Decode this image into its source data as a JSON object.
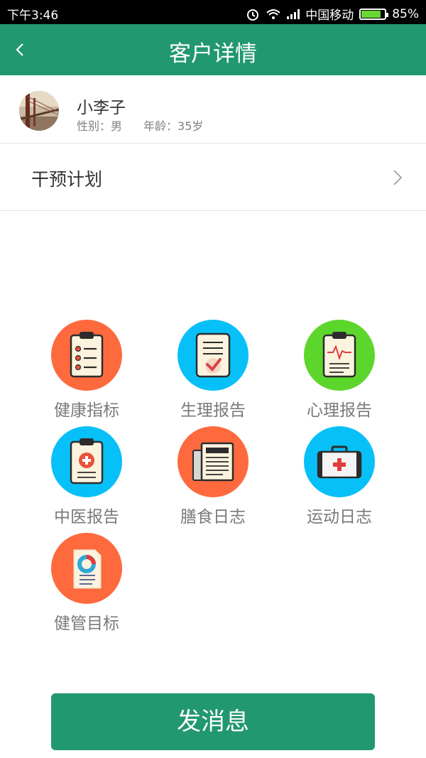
{
  "status_bar": {
    "time": "下午3:46",
    "carrier": "中国移动",
    "battery": "85%",
    "battery_level": 0.85
  },
  "header": {
    "title": "客户详情",
    "back_icon": "chevron-left-icon"
  },
  "profile": {
    "name": "小李子",
    "gender": "性别：男",
    "age": "年龄：35岁"
  },
  "plan": {
    "label": "干预计划",
    "icon": "chevron-right-icon"
  },
  "grid": [
    {
      "label": "健康指标",
      "icon": "clipboard-list-icon",
      "color": "#fe6a3d"
    },
    {
      "label": "生理报告",
      "icon": "document-check-icon",
      "color": "#08c0f8"
    },
    {
      "label": "心理报告",
      "icon": "clipboard-heartbeat-icon",
      "color": "#5dd62c"
    },
    {
      "label": "中医报告",
      "icon": "clipboard-medical-icon",
      "color": "#08c0f8"
    },
    {
      "label": "膳食日志",
      "icon": "newspaper-icon",
      "color": "#fe6a3d"
    },
    {
      "label": "运动日志",
      "icon": "first-aid-kit-icon",
      "color": "#08c0f8"
    },
    {
      "label": "健管目标",
      "icon": "report-chart-icon",
      "color": "#fe6a3d"
    }
  ],
  "send_button": {
    "label": "发消息"
  },
  "colors": {
    "primary": "#21986f",
    "orange": "#fe6a3d",
    "blue": "#08c0f8",
    "green": "#5dd62c"
  }
}
